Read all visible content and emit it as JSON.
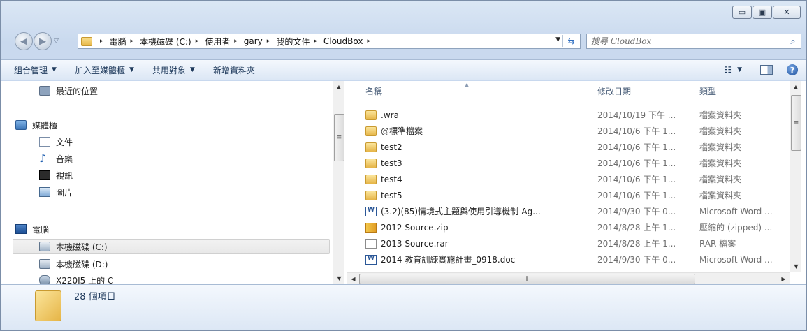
{
  "window": {
    "caption_buttons": {
      "minimize": "▭",
      "maximize": "▣",
      "close": "✕"
    }
  },
  "nav": {
    "back_icon": "◀",
    "forward_icon": "▶"
  },
  "address": {
    "crumbs": [
      "電腦",
      "本機磁碟 (C:)",
      "使用者",
      "gary",
      "我的文件",
      "CloudBox"
    ],
    "separator": "▸"
  },
  "search": {
    "placeholder": "搜尋 CloudBox"
  },
  "toolbar": {
    "organize": "組合管理",
    "add_to_library": "加入至媒體櫃",
    "share_with": "共用對象",
    "new_folder": "新增資料夾"
  },
  "navpane": {
    "recent": "最近的位置",
    "libraries": "媒體櫃",
    "documents": "文件",
    "music": "音樂",
    "videos": "視訊",
    "pictures": "圖片",
    "computer": "電腦",
    "drive_c": "本機磁碟 (C:)",
    "drive_d": "本機磁碟 (D:)",
    "net_drive": "X220I5 上的 C"
  },
  "columns": {
    "name": "名稱",
    "date": "修改日期",
    "type": "類型"
  },
  "files": [
    {
      "name": ".wra",
      "date": "2014/10/19 下午 ...",
      "type": "檔案資料夾",
      "icon": "folder-icon"
    },
    {
      "name": "@標準檔案",
      "date": "2014/10/6 下午 1...",
      "type": "檔案資料夾",
      "icon": "folder-icon"
    },
    {
      "name": "test2",
      "date": "2014/10/6 下午 1...",
      "type": "檔案資料夾",
      "icon": "folder-icon"
    },
    {
      "name": "test3",
      "date": "2014/10/6 下午 1...",
      "type": "檔案資料夾",
      "icon": "folder-icon"
    },
    {
      "name": "test4",
      "date": "2014/10/6 下午 1...",
      "type": "檔案資料夾",
      "icon": "folder-icon"
    },
    {
      "name": "test5",
      "date": "2014/10/6 下午 1...",
      "type": "檔案資料夾",
      "icon": "folder-icon"
    },
    {
      "name": "(3.2)(85)情境式主題與使用引導機制-Ag...",
      "date": "2014/9/30 下午 0...",
      "type": "Microsoft Word ...",
      "icon": "word-doc-icon"
    },
    {
      "name": "2012 Source.zip",
      "date": "2014/8/28 上午 1...",
      "type": "壓縮的 (zipped) ...",
      "icon": "zip-icon"
    },
    {
      "name": "2013 Source.rar",
      "date": "2014/8/28 上午 1...",
      "type": "RAR 檔案",
      "icon": "file-icon"
    },
    {
      "name": "2014 教育訓練實施計畫_0918.doc",
      "date": "2014/9/30 下午 0...",
      "type": "Microsoft Word ...",
      "icon": "word-doc-icon"
    }
  ],
  "details": {
    "item_count": "28 個項目"
  }
}
